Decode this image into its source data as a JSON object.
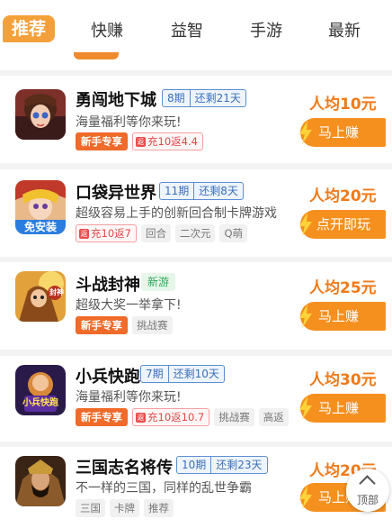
{
  "tabs": {
    "active": "推荐",
    "items": [
      "快赚",
      "益智",
      "手游",
      "最新"
    ]
  },
  "games": [
    {
      "title": "勇闯地下城",
      "period": "8期",
      "remain": "还剩21天",
      "desc": "海量福利等你来玩!",
      "tags": {
        "newbie": "新手专享",
        "recharge": "充10返4.4"
      },
      "avg": "人均10元",
      "cta": "马上赚"
    },
    {
      "title": "口袋异世界",
      "period": "11期",
      "remain": "还剩8天",
      "desc": "超级容易上手的创新回合制卡牌游戏",
      "icon_text": "免安装",
      "tags": {
        "recharge": "充10返7",
        "plain": [
          "回合",
          "二次元",
          "Q萌"
        ]
      },
      "avg": "人均20元",
      "cta": "点开即玩"
    },
    {
      "title": "斗战封神",
      "new_badge": "新游",
      "desc": "超级大奖一举拿下!",
      "icon_text": "封神",
      "tags": {
        "newbie": "新手专享",
        "plain": [
          "挑战赛"
        ]
      },
      "avg": "人均25元",
      "cta": "马上赚"
    },
    {
      "title": "小兵快跑",
      "period": "7期",
      "remain": "还剩10天",
      "desc": "海量福利等你来玩!",
      "icon_text": "小兵快跑",
      "tags": {
        "newbie": "新手专享",
        "recharge": "充10返10.7",
        "plain": [
          "挑战赛",
          "高返"
        ]
      },
      "avg": "人均30元",
      "cta": "马上赚"
    },
    {
      "title": "三国志名将传",
      "period": "10期",
      "remain": "还剩23天",
      "desc": "不一样的三国，同样的乱世争霸",
      "tags": {
        "plain": [
          "三国",
          "卡牌",
          "推荐"
        ]
      },
      "avg": "人均20元",
      "cta": "马上赚"
    }
  ],
  "recharge_mark": "返",
  "back_to_top": "顶部",
  "colors": {
    "accent": "#f5901f",
    "badge_blue": "#3a6fb8",
    "new_green": "#2fa55a"
  }
}
